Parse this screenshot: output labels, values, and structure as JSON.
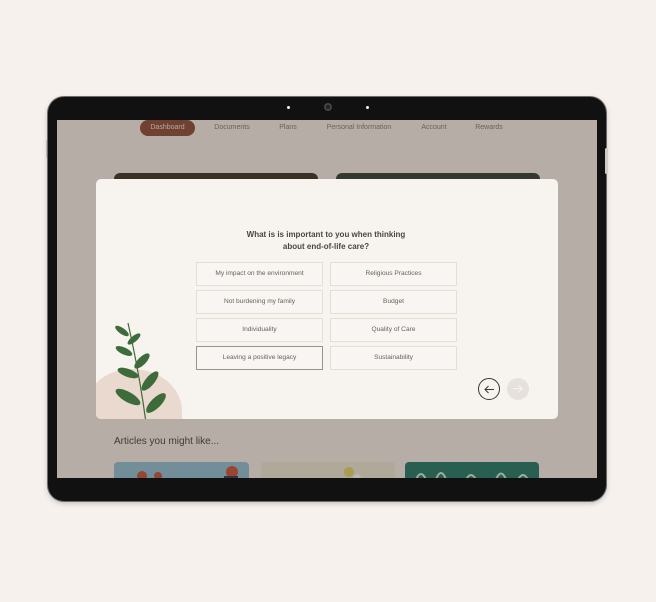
{
  "nav": {
    "items": [
      {
        "label": "Dashboard",
        "active": true
      },
      {
        "label": "Documents",
        "active": false
      },
      {
        "label": "Plans",
        "active": false
      },
      {
        "label": "Personal Information",
        "active": false
      },
      {
        "label": "Account",
        "active": false
      },
      {
        "label": "Rewards",
        "active": false
      }
    ]
  },
  "modal": {
    "question_line1": "What is is important to you when thinking",
    "question_line2": "about end-of-life care?",
    "options": [
      "My impact on the environment",
      "Religious Practices",
      "Not burdening my family",
      "Budget",
      "Individuality",
      "Quality of Care",
      "Leaving a positive legacy",
      "Sustainability"
    ],
    "selected_option": "Leaving a positive legacy",
    "prev_icon": "arrow-left-icon",
    "next_icon": "arrow-right-icon"
  },
  "articles": {
    "title": "Articles you might like..."
  },
  "colors": {
    "accent": "#8c4a3a",
    "background": "#f6f1ed",
    "modal_bg": "#f7f3ef",
    "plant_green": "#3e6b3a",
    "blob": "#ead9cf"
  }
}
